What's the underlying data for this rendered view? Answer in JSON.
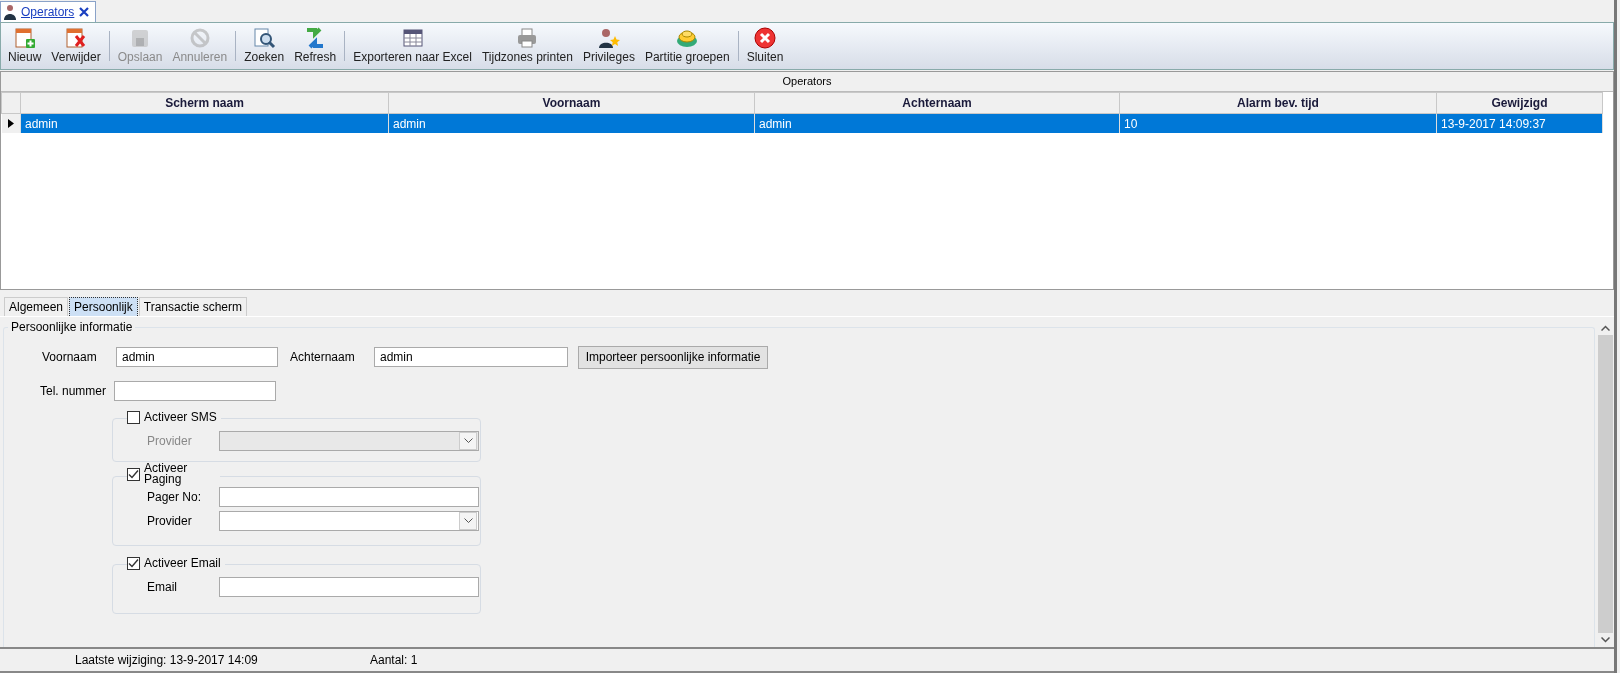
{
  "document_tab": {
    "title": "Operators"
  },
  "toolbar": {
    "groups": [
      [
        {
          "label": "Nieuw",
          "disabled": false
        },
        {
          "label": "Verwijder",
          "disabled": false
        }
      ],
      [
        {
          "label": "Opslaan",
          "disabled": true
        },
        {
          "label": "Annuleren",
          "disabled": true
        }
      ],
      [
        {
          "label": "Zoeken",
          "disabled": false
        },
        {
          "label": "Refresh",
          "disabled": false
        }
      ],
      [
        {
          "label": "Exporteren naar Excel",
          "disabled": false
        },
        {
          "label": "Tijdzones printen",
          "disabled": false
        },
        {
          "label": "Privileges",
          "disabled": false
        },
        {
          "label": "Partitie groepen",
          "disabled": false
        }
      ],
      [
        {
          "label": "Sluiten",
          "disabled": false
        }
      ]
    ]
  },
  "grid": {
    "caption": "Operators",
    "columns": [
      "Scherm naam",
      "Voornaam",
      "Achternaam",
      "Alarm bev. tijd",
      "Gewijzigd"
    ],
    "rows": [
      {
        "selected": true,
        "cells": [
          "admin",
          "admin",
          "admin",
          "10",
          "13-9-2017 14:09:37"
        ]
      }
    ]
  },
  "detail_tabs": [
    {
      "label": "Algemeen",
      "selected": false
    },
    {
      "label": "Persoonlijk",
      "selected": true
    },
    {
      "label": "Transactie scherm",
      "selected": false
    }
  ],
  "personal_info": {
    "title": "Persoonlijke informatie",
    "first_name": {
      "label": "Voornaam",
      "value": "admin"
    },
    "last_name": {
      "label": "Achternaam",
      "value": "admin"
    },
    "import_button": "Importeer persoonlijke informatie",
    "phone": {
      "label": "Tel. nummer"
    },
    "sms": {
      "label": "Activeer SMS",
      "checked": false,
      "provider_label": "Provider"
    },
    "paging": {
      "label": "Activeer Paging",
      "checked": true,
      "pager_label": "Pager No:",
      "provider_label": "Provider"
    },
    "email": {
      "label": "Activeer Email",
      "checked": true,
      "email_label": "Email"
    }
  },
  "status_bar": [
    "Laatste wijziging: 13-9-2017 14:09",
    "Aantal: 1"
  ]
}
